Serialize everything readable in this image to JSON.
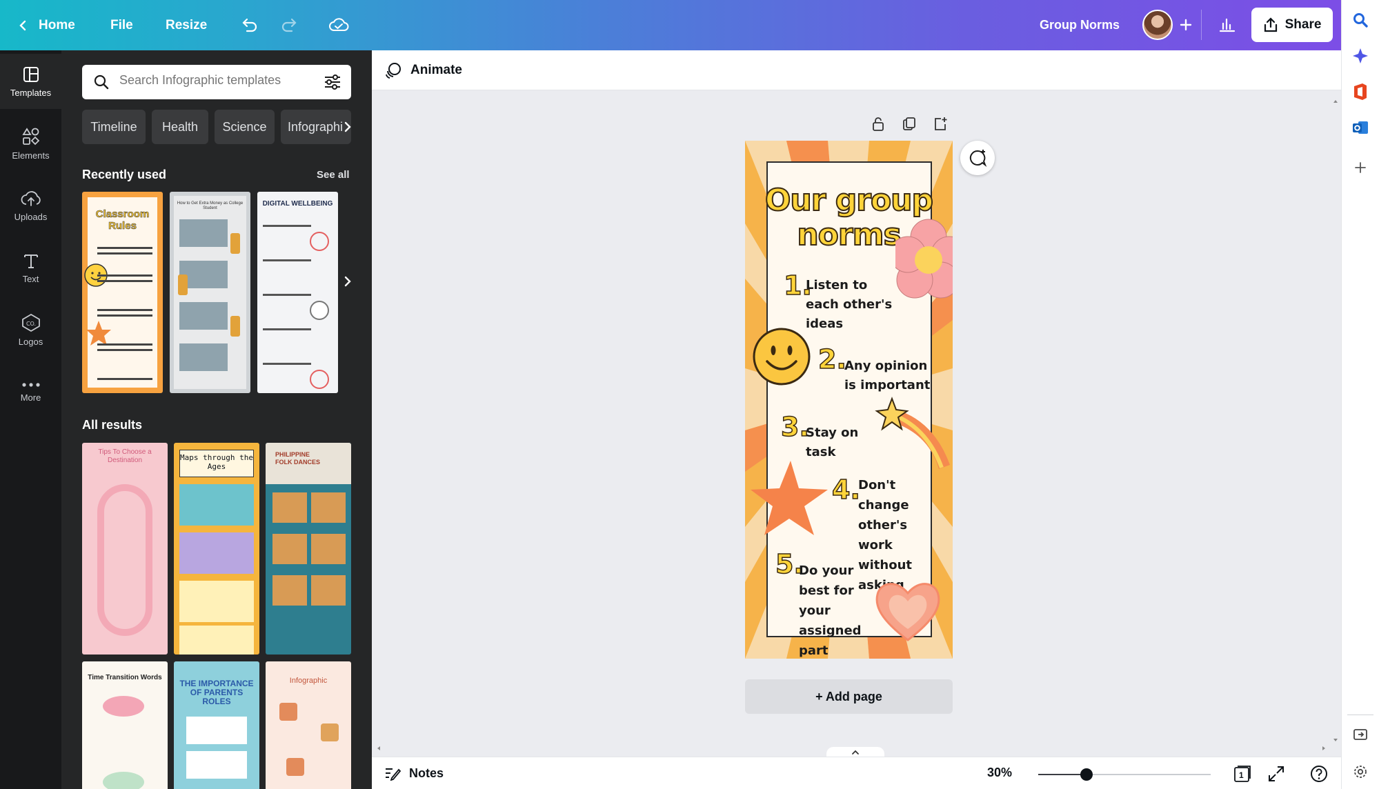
{
  "topbar": {
    "home": "Home",
    "file": "File",
    "resize": "Resize",
    "doc_title": "Group Norms",
    "share": "Share"
  },
  "nav": {
    "items": [
      {
        "label": "Templates",
        "icon": "templates-icon"
      },
      {
        "label": "Elements",
        "icon": "elements-icon"
      },
      {
        "label": "Uploads",
        "icon": "uploads-icon"
      },
      {
        "label": "Text",
        "icon": "text-icon"
      },
      {
        "label": "Logos",
        "icon": "logos-icon"
      },
      {
        "label": "More",
        "icon": "more-icon"
      }
    ]
  },
  "panel": {
    "search_placeholder": "Search Infographic templates",
    "chips": [
      "Timeline",
      "Health",
      "Science",
      "Infographi"
    ],
    "recently_used_title": "Recently used",
    "see_all": "See all",
    "all_results_title": "All results",
    "recent_thumbs": [
      {
        "title": "Classroom Rules"
      },
      {
        "title": "How to Get Extra Money as College Student"
      },
      {
        "title": "DIGITAL WELLBEING"
      }
    ],
    "result_thumbs": [
      {
        "title": "Tips To Choose a Destination"
      },
      {
        "title": "Maps through the Ages"
      },
      {
        "title": "PHILIPPINE FOLK DANCES"
      },
      {
        "title": "Time Transition Words"
      },
      {
        "title": "THE IMPORTANCE OF PARENTS ROLES"
      },
      {
        "title": "Infographic"
      }
    ]
  },
  "editor": {
    "animate": "Animate",
    "add_page": "+ Add page",
    "notes": "Notes",
    "zoom": "30%",
    "zoom_fraction": 0.28,
    "page_count": "1"
  },
  "design": {
    "title_line1": "Our group",
    "title_line2": "norms",
    "norms": [
      {
        "num": "1.",
        "text": "Listen to each other's ideas"
      },
      {
        "num": "2.",
        "text": "Any opinion is important"
      },
      {
        "num": "3.",
        "text": "Stay on task"
      },
      {
        "num": "4.",
        "text": "Don't change other's work without asking"
      },
      {
        "num": "5.",
        "text": "Do your best for your assigned part"
      }
    ]
  },
  "colors": {
    "accent_gradient_start": "#17b8c9",
    "accent_gradient_end": "#7c4ee6",
    "panel_bg": "#252627",
    "rail_bg": "#18191b",
    "canvas_bg": "#ebecf0",
    "design_orange": "#f6a94a",
    "design_title_yellow": "#ffd43a"
  }
}
